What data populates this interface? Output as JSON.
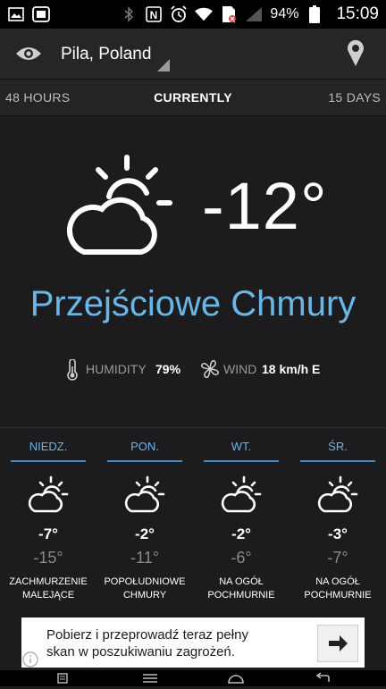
{
  "status_bar": {
    "battery": "94%",
    "time": "15:09"
  },
  "header": {
    "location": "Pila, Poland"
  },
  "tabs": {
    "left": "48 HOURS",
    "center": "CURRENTLY",
    "right": "15 DAYS"
  },
  "current": {
    "temperature": "-12°",
    "condition": "Przejściowe Chmury",
    "humidity_label": "HUMIDITY",
    "humidity_value": "79%",
    "wind_label": "WIND",
    "wind_value": "18 km/h E"
  },
  "forecast": [
    {
      "day": "NIEDZ.",
      "high": "-7°",
      "low": "-15°",
      "desc_line1": "ZACHMURZENIE",
      "desc_line2": "MALEJĄCE"
    },
    {
      "day": "PON.",
      "high": "-2°",
      "low": "-11°",
      "desc_line1": "POPOŁUDNIOWE",
      "desc_line2": "CHMURY"
    },
    {
      "day": "WT.",
      "high": "-2°",
      "low": "-6°",
      "desc_line1": "NA OGÓŁ",
      "desc_line2": "POCHMURNIE"
    },
    {
      "day": "ŚR.",
      "high": "-3°",
      "low": "-7°",
      "desc_line1": "NA OGÓŁ",
      "desc_line2": "POCHMURNIE"
    }
  ],
  "ad": {
    "line1": "Pobierz i przeprowadź teraz pełny",
    "line2": "skan w poszukiwaniu zagrożeń."
  },
  "colors": {
    "accent": "#6ab6e6",
    "background": "#1c1c1e"
  }
}
